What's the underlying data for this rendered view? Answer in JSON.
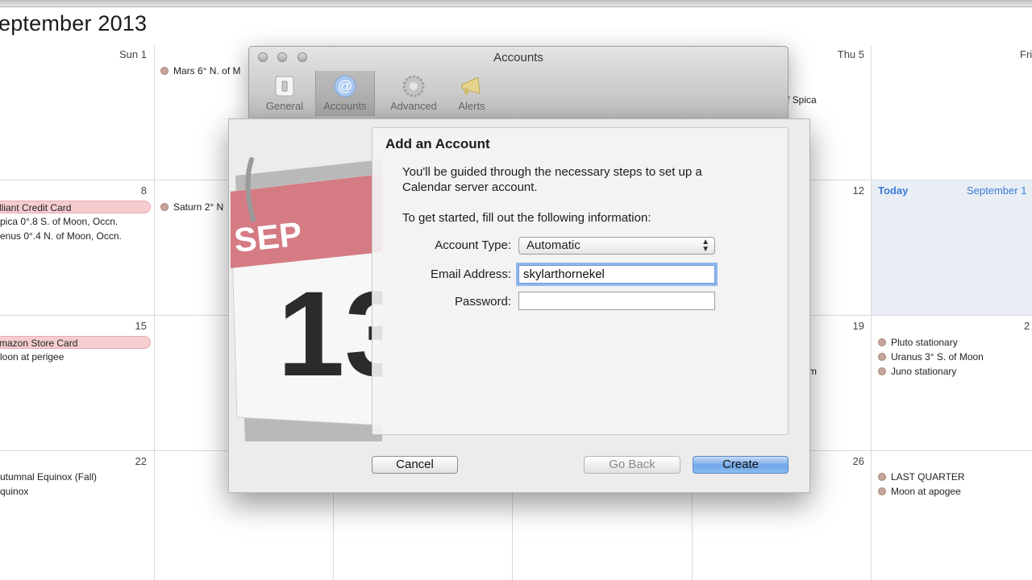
{
  "calendar": {
    "month_title": "eptember 2013",
    "day_numbers": {
      "sun1": "Sun 1",
      "thu5": "Thu 5",
      "fri": "Fri",
      "d8": "8",
      "d12": "12",
      "d15": "15",
      "d19": "19",
      "d22": "22",
      "d26": "26",
      "d2": "2"
    },
    "today_label": "Today",
    "today_month": "September 1",
    "events": {
      "mars": "Mars 6° N. of M",
      "spica_clip": "f Spica",
      "credit_card": "lliant Credit Card",
      "spica_occn": "pica 0°.8 S. of Moon, Occn.",
      "venus_occn": "enus 0°.4 N. of Moon, Occn.",
      "saturn": "Saturn 2° N",
      "amazon": "mazon Store Card",
      "perigee": "loon at perigee",
      "m_clip": "m",
      "pluto": "Pluto stationary",
      "uranus": "Uranus 3° S. of Moon",
      "juno": "Juno stationary",
      "equinox_fall": "utumnal Equinox (Fall)",
      "equinox": "quinox",
      "last_quarter": "LAST QUARTER",
      "apogee": "Moon at apogee"
    }
  },
  "prefs_window": {
    "title": "Accounts",
    "toolbar": [
      "General",
      "Accounts",
      "Advanced",
      "Alerts"
    ]
  },
  "sheet": {
    "heading": "Add an Account",
    "intro_line1": "You'll be guided through the necessary steps to set up a",
    "intro_line2": "Calendar server account.",
    "instruction": "To get started, fill out the following information:",
    "account_type_label": "Account Type:",
    "account_type_value": "Automatic",
    "email_label": "Email Address:",
    "email_value": "skylarthornekel",
    "password_label": "Password:",
    "password_value": "",
    "icon_month": "SEP",
    "icon_day": "13",
    "buttons": {
      "cancel": "Cancel",
      "go_back": "Go Back",
      "create": "Create"
    }
  },
  "colors": {
    "accent": "#3a7bd5",
    "event_pill": "#f5cdd1",
    "event_dot": "#c8a59a",
    "today_bg": "#e9eef5"
  }
}
